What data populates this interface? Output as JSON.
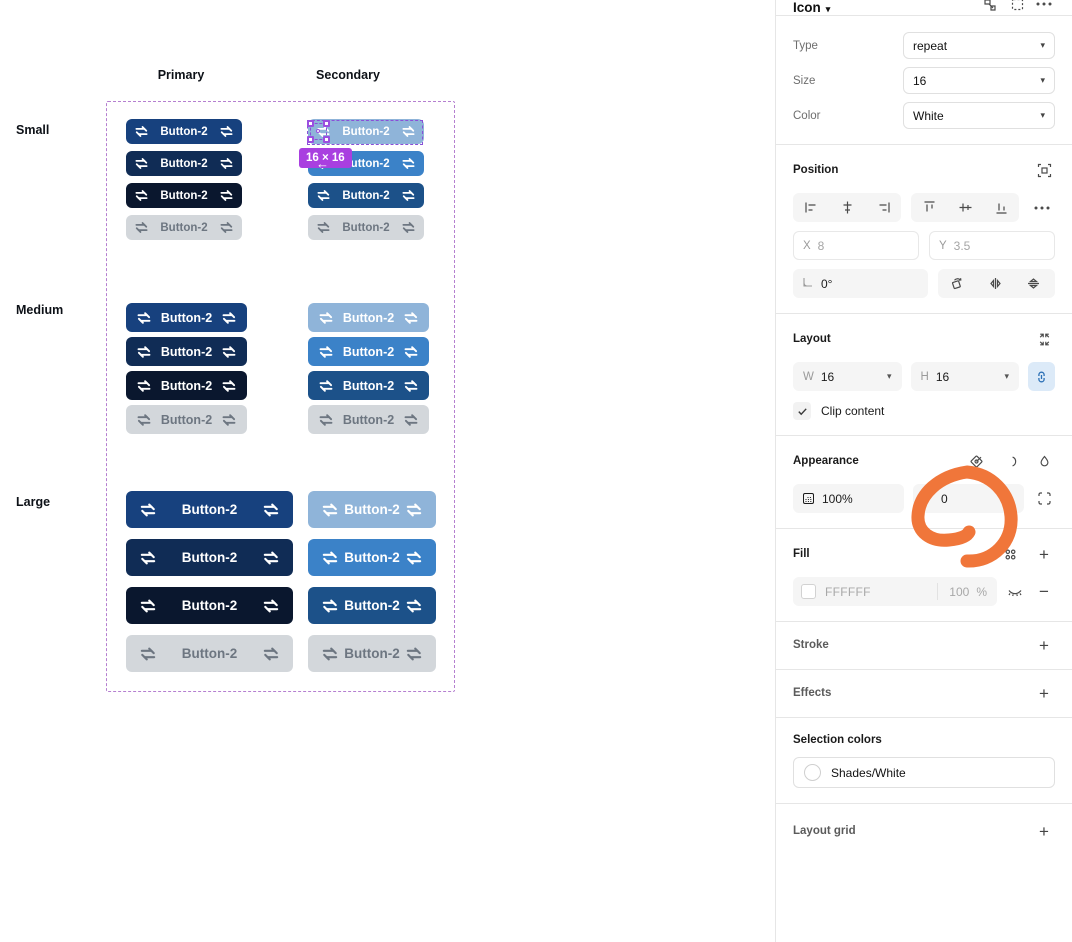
{
  "canvas": {
    "column_headers": [
      "Primary",
      "Secondary"
    ],
    "row_labels": [
      "Small",
      "Medium",
      "Large"
    ],
    "button_label": "Button-2",
    "selection_badge": "16 × 16",
    "frame_border_color": "#b57fd0",
    "selection_color": "#9b4fe0",
    "colors": {
      "primary_default": "#17417e",
      "primary_hover": "#102c55",
      "primary_pressed": "#0a172e",
      "primary_disabled": "#d3d7db",
      "secondary_default": "#8fb4d9",
      "secondary_hover": "#3b82c8",
      "secondary_pressed": "#1c5189",
      "secondary_disabled": "#d3d7db",
      "disabled_text": "#6d7681"
    }
  },
  "panel": {
    "title": "Icon",
    "title_chevron": "chevron-down-icon",
    "icon_section": {
      "rows": [
        {
          "key": "Type",
          "value": "repeat"
        },
        {
          "key": "Size",
          "value": "16"
        },
        {
          "key": "Color",
          "value": "White"
        }
      ]
    },
    "position": {
      "title": "Position",
      "align_left": "align-left-icon",
      "align_center_h": "align-horizontal-center-icon",
      "align_right": "align-right-icon",
      "align_top": "align-top-icon",
      "align_center_v": "align-vertical-center-icon",
      "align_bottom": "align-bottom-icon",
      "more": "...",
      "x_key": "X",
      "x_value": "8",
      "y_key": "Y",
      "y_value": "3.5",
      "rotation_value": "0°",
      "rotate_icon": "rotate-icon",
      "flip_h_icon": "flip-horizontal-icon",
      "flip_v_icon": "flip-vertical-icon"
    },
    "layout": {
      "title": "Layout",
      "resize_icon": "collapse-to-fit-icon",
      "w_key": "W",
      "w_value": "16",
      "h_key": "H",
      "h_value": "16",
      "link_icon": "link-constraint-icon",
      "clip_content_label": "Clip content",
      "clip_content_checked": true
    },
    "appearance": {
      "title": "Appearance",
      "opacity_value": "100%",
      "corner_radius_value": "0",
      "blend_icon": "blend-mode-icon",
      "half_moon_icon": "contrast-icon",
      "drop_icon": "drop-shadow-icon",
      "independent_corners_icon": "independent-corners-icon"
    },
    "fill": {
      "title": "Fill",
      "styles_icon": "styles-grid-icon",
      "add_icon": "+",
      "hex_value": "FFFFFF",
      "opacity_value": "100",
      "percent": "%",
      "visibility_icon": "eye-off-icon",
      "remove_icon": "−"
    },
    "stroke": {
      "title": "Stroke",
      "add_icon": "+"
    },
    "effects": {
      "title": "Effects",
      "add_icon": "+"
    },
    "selection_colors": {
      "title": "Selection colors",
      "items": [
        {
          "name": "Shades/White",
          "swatch": "#ffffff"
        }
      ]
    },
    "layout_grid": {
      "title": "Layout grid",
      "add_icon": "+"
    }
  },
  "annotation": {
    "shape": "hand-drawn-circle",
    "color": "#f0763a"
  }
}
